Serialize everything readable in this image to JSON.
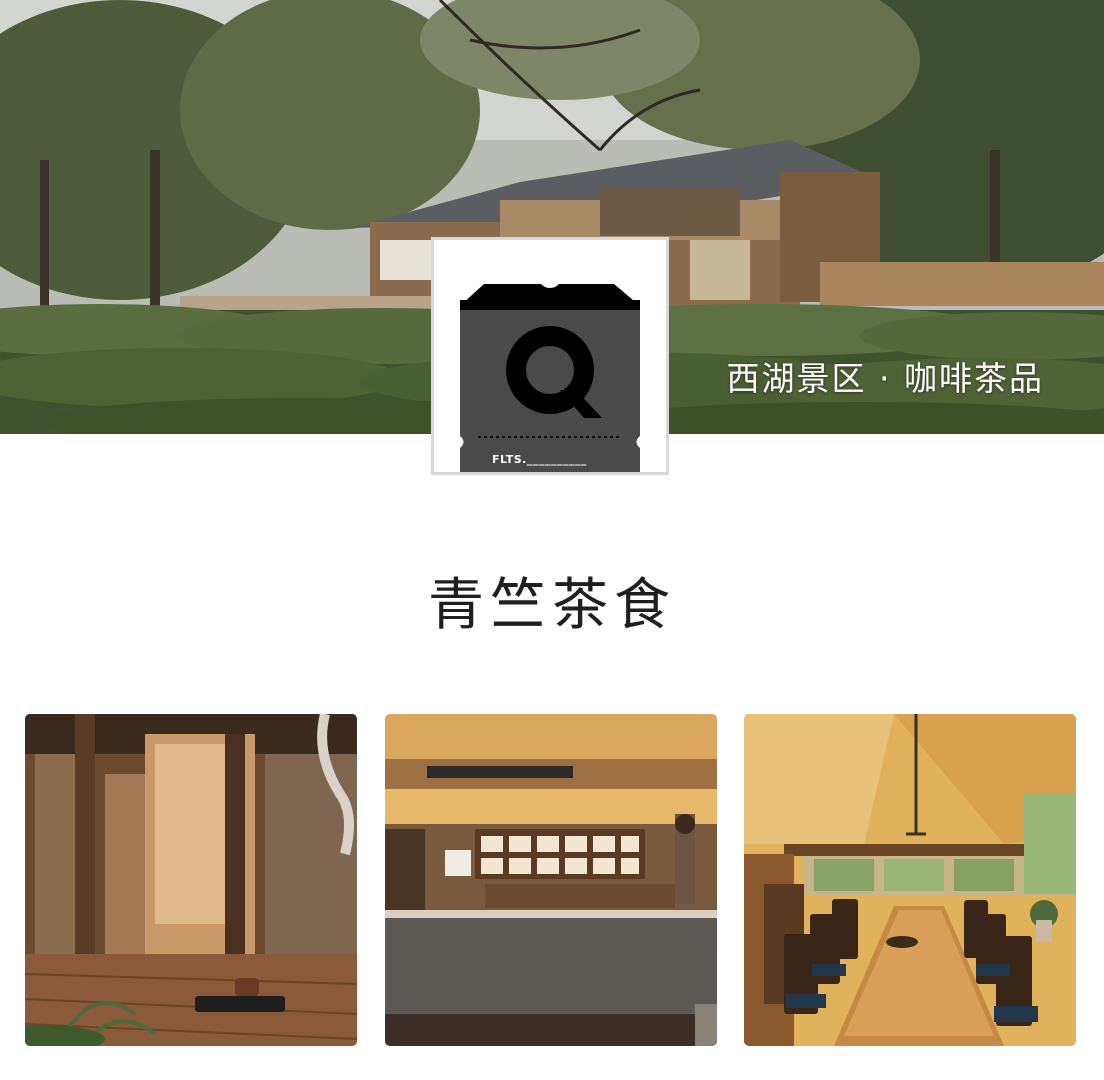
{
  "hero": {
    "tagline": "西湖景区 · 咖啡茶品",
    "image_icon": "tea-garden-house-photo"
  },
  "logo": {
    "icon": "luggage-tag-q-logo",
    "letter": "Q",
    "tag_text": "FLTS.__________"
  },
  "shop": {
    "title": "青竺茶食"
  },
  "gallery": {
    "photos": [
      {
        "icon": "wooden-veranda-photo"
      },
      {
        "icon": "tea-counter-photo"
      },
      {
        "icon": "dining-hall-photo"
      }
    ]
  },
  "colors": {
    "title": "#1f1f1f",
    "tagline": "#ffffff",
    "logo_dark": "#000000",
    "logo_grey": "#4a4a4a",
    "card_border": "#d9d9d9"
  }
}
